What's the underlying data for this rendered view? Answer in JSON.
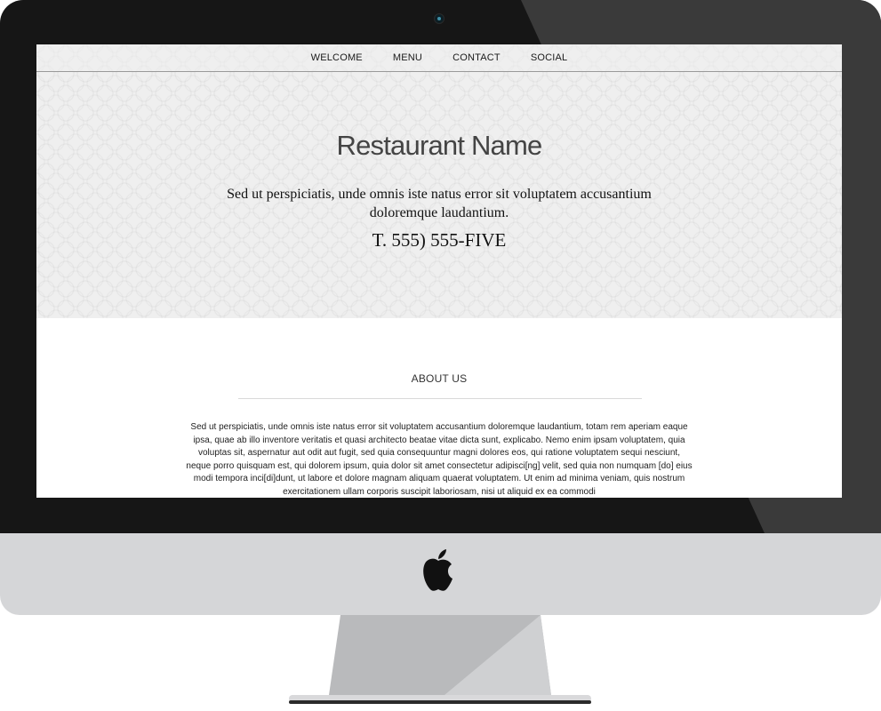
{
  "nav": {
    "items": [
      "WELCOME",
      "MENU",
      "CONTACT",
      "SOCIAL"
    ]
  },
  "hero": {
    "title": "Restaurant Name",
    "tagline": "Sed ut perspiciatis, unde omnis iste natus error sit voluptatem accusantium doloremque laudantium.",
    "phone": "T. 555) 555-FIVE"
  },
  "about": {
    "heading": "ABOUT US",
    "body": "Sed ut perspiciatis, unde omnis iste natus error sit voluptatem accusantium doloremque laudantium, totam rem aperiam eaque ipsa, quae ab illo inventore veritatis et quasi architecto beatae vitae dicta sunt, explicabo. Nemo enim ipsam voluptatem, quia voluptas sit, aspernatur aut odit aut fugit, sed quia consequuntur magni dolores eos, qui ratione voluptatem sequi nesciunt, neque porro quisquam est, qui dolorem ipsum, quia dolor sit amet consectetur adipisci[ng] velit, sed quia non numquam [do] eius modi tempora inci[di]dunt, ut labore et dolore magnam aliquam quaerat voluptatem. Ut enim ad minima veniam, quis nostrum exercitationem ullam corporis suscipit laboriosam, nisi ut aliquid ex ea commodi"
  },
  "device": {
    "logo_icon": "apple-logo-icon",
    "bezel_color": "#161616",
    "chin_color": "#d5d6d8"
  }
}
